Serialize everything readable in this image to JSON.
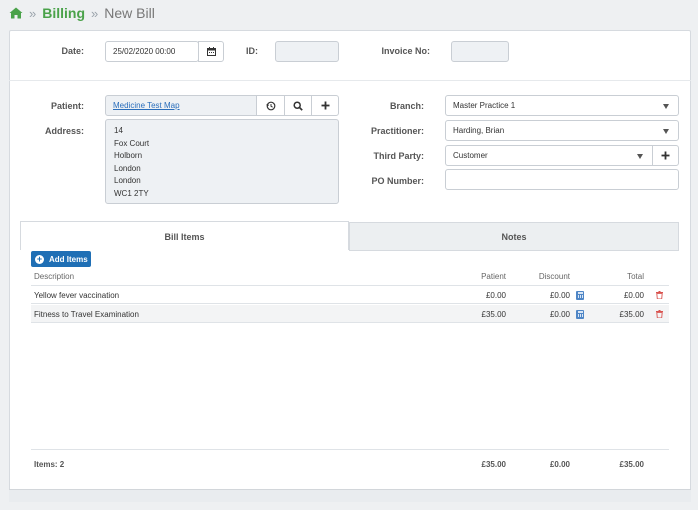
{
  "breadcrumb": {
    "home_icon": "home-icon",
    "section": "Billing",
    "page": "New Bill"
  },
  "header": {
    "date_label": "Date:",
    "date_value": "25/02/2020 00:00",
    "id_label": "ID:",
    "id_value": "",
    "invoice_label": "Invoice No:",
    "invoice_value": ""
  },
  "patient": {
    "label": "Patient:",
    "value": "Medicine Test Map",
    "address_label": "Address:",
    "address_lines": [
      "14",
      "Fox Court",
      "Holborn",
      "London",
      "London",
      "WC1 2TY"
    ]
  },
  "branch": {
    "label": "Branch:",
    "value": "Master Practice 1"
  },
  "practitioner": {
    "label": "Practitioner:",
    "value": "Harding, Brian"
  },
  "third_party": {
    "label": "Third Party:",
    "value": "Customer"
  },
  "po_number": {
    "label": "PO Number:",
    "value": ""
  },
  "tabs": [
    {
      "label": "Bill Items",
      "active": true
    },
    {
      "label": "Notes",
      "active": false
    }
  ],
  "add_items_label": "Add Items",
  "columns": {
    "description": "Description",
    "patient": "Patient",
    "discount": "Discount",
    "total": "Total"
  },
  "items": [
    {
      "description": "Yellow fever vaccination",
      "patient": "£0.00",
      "discount": "£0.00",
      "total": "£0.00"
    },
    {
      "description": "Fitness to Travel Examination",
      "patient": "£35.00",
      "discount": "£0.00",
      "total": "£35.00"
    }
  ],
  "footer": {
    "items_count": "Items: 2",
    "patient_total": "£35.00",
    "discount_total": "£0.00",
    "grand_total": "£35.00"
  },
  "colors": {
    "brand_green": "#4aa24a",
    "primary_blue": "#1f6fb5",
    "delete_red": "#d9534f"
  }
}
